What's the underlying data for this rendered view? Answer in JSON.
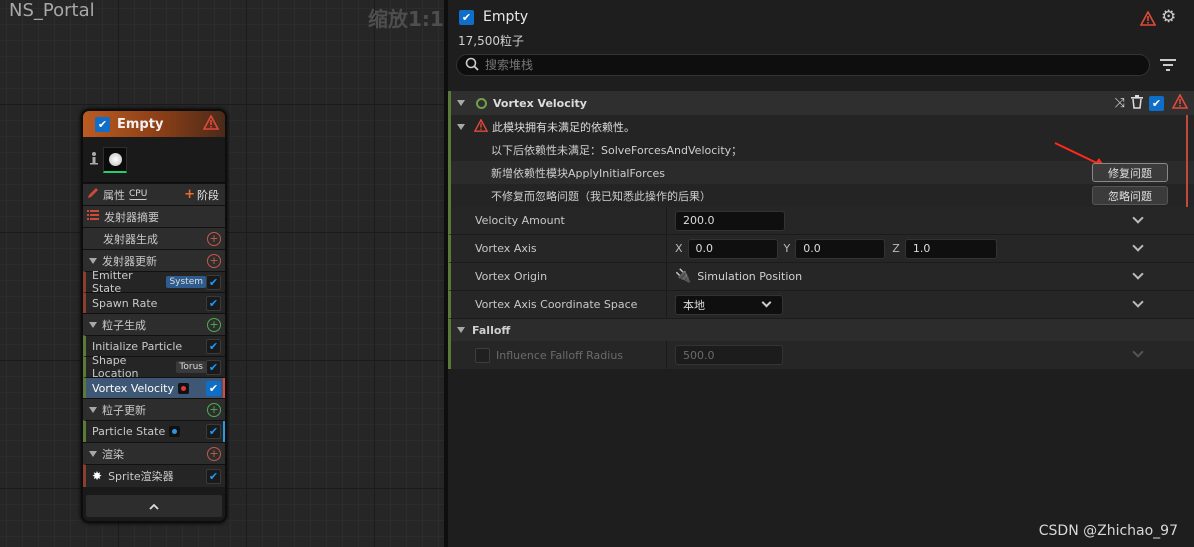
{
  "graph": {
    "title": "NS_Portal",
    "zoom": "缩放1:1"
  },
  "node": {
    "title": "Empty",
    "properties_label": "属性",
    "sim_target": "CPU",
    "add_stage_label": "阶段",
    "rows": [
      {
        "label": "发射器摘要"
      },
      {
        "label": "发射器生成"
      },
      {
        "label": "发射器更新"
      },
      {
        "label": "Emitter State",
        "tag": "System"
      },
      {
        "label": "Spawn Rate"
      },
      {
        "label": "粒子生成"
      },
      {
        "label": "Initialize Particle"
      },
      {
        "label": "Shape Location",
        "tag": "Torus"
      },
      {
        "label": "Vortex Velocity"
      },
      {
        "label": "粒子更新"
      },
      {
        "label": "Particle State"
      },
      {
        "label": "渲染"
      },
      {
        "label": "Sprite渲染器"
      }
    ]
  },
  "panel": {
    "emitter_name": "Empty",
    "particle_count": "17,500粒子",
    "search_placeholder": "搜索堆栈",
    "module_title": "Vortex Velocity",
    "error_title": "此模块拥有未满足的依赖性。",
    "dependency_text": "以下后依赖性未满足：SolveForcesAndVelocity；",
    "fix_text": "新增依赖性模块ApplyInitialForces",
    "fix_button": "修复问题",
    "ignore_text": "不修复而忽略问题（我已知悉此操作的后果）",
    "ignore_button": "忽略问题",
    "properties": {
      "velocity_amount": {
        "label": "Velocity Amount",
        "value": "200.0"
      },
      "vortex_axis": {
        "label": "Vortex Axis",
        "x_label": "X",
        "x": "0.0",
        "y_label": "Y",
        "y": "0.0",
        "z_label": "Z",
        "z": "1.0"
      },
      "vortex_origin": {
        "label": "Vortex Origin",
        "value": "Simulation Position"
      },
      "coord_space": {
        "label": "Vortex Axis Coordinate Space",
        "value": "本地"
      }
    },
    "falloff": {
      "title": "Falloff",
      "radius_label": "Influence Falloff Radius",
      "radius_value": "500.0"
    }
  },
  "watermark": "CSDN @Zhichao_97",
  "colors": {
    "accent_blue": "#0e6ec8",
    "error_red": "#c24a3c",
    "module_green": "#5b7a3a",
    "node_header_orange": "#bb5b22"
  }
}
